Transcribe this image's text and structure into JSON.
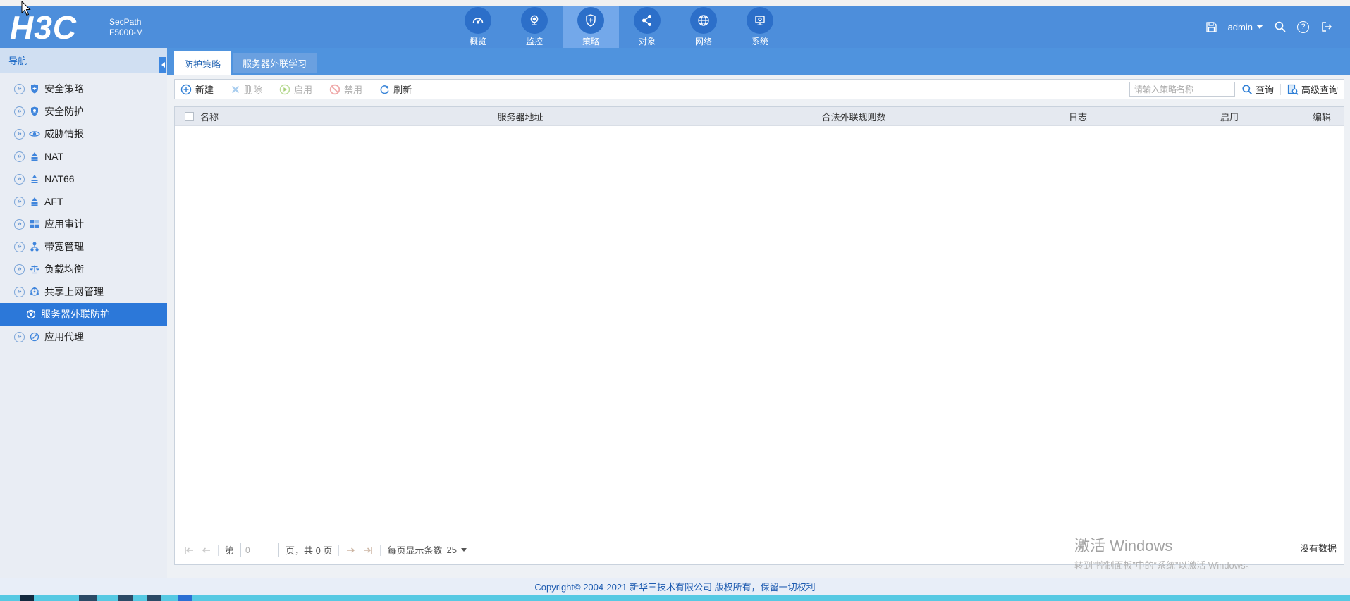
{
  "header": {
    "logo_text": "H3C",
    "product_name_line1": "SecPath",
    "product_name_line2": "F5000-M",
    "nav_items": [
      {
        "label": "概览",
        "icon": "gauge-icon",
        "active": false
      },
      {
        "label": "监控",
        "icon": "webcam-icon",
        "active": false
      },
      {
        "label": "策略",
        "icon": "shield-plus-icon",
        "active": true
      },
      {
        "label": "对象",
        "icon": "share-nodes-icon",
        "active": false
      },
      {
        "label": "网络",
        "icon": "globe-icon",
        "active": false
      },
      {
        "label": "系统",
        "icon": "system-monitor-icon",
        "active": false
      }
    ],
    "username": "admin"
  },
  "sidebar": {
    "title": "导航",
    "items": [
      {
        "label": "安全策略",
        "icon": "shield-plus-icon"
      },
      {
        "label": "安全防护",
        "icon": "shield-check-icon"
      },
      {
        "label": "威胁情报",
        "icon": "eye-icon"
      },
      {
        "label": "NAT",
        "icon": "nat-icon"
      },
      {
        "label": "NAT66",
        "icon": "nat-icon"
      },
      {
        "label": "AFT",
        "icon": "nat-icon"
      },
      {
        "label": "应用审计",
        "icon": "app-audit-icon"
      },
      {
        "label": "带宽管理",
        "icon": "bandwidth-icon"
      },
      {
        "label": "负载均衡",
        "icon": "load-balance-icon"
      },
      {
        "label": "共享上网管理",
        "icon": "shared-internet-icon"
      },
      {
        "label": "服务器外联防护",
        "icon": "server-outreach-icon",
        "selected": true
      },
      {
        "label": "应用代理",
        "icon": "app-proxy-icon"
      }
    ]
  },
  "tabs": [
    {
      "label": "防护策略",
      "active": true
    },
    {
      "label": "服务器外联学习",
      "active": false
    }
  ],
  "toolbar": {
    "new_label": "新建",
    "delete_label": "删除",
    "enable_label": "启用",
    "disable_label": "禁用",
    "refresh_label": "刷新",
    "search_placeholder": "请输入策略名称",
    "query_label": "查询",
    "advanced_query_label": "高级查询"
  },
  "table": {
    "columns": [
      "名称",
      "服务器地址",
      "合法外联规则数",
      "日志",
      "启用",
      "编辑"
    ],
    "rows": [],
    "empty_text": "没有数据"
  },
  "pagination": {
    "page_label_before": "第",
    "page_value": "0",
    "page_label_after": "页，共 0 页",
    "per_page_label": "每页显示条数",
    "per_page_value": "25"
  },
  "watermark": {
    "title": "激活 Windows",
    "subtitle": "转到“控制面板”中的“系统”以激活 Windows。"
  },
  "footer": {
    "copyright": "Copyright© 2004-2021 新华三技术有限公司 版权所有，保留一切权利"
  },
  "colors": {
    "header_blue": "#4d8edb",
    "nav_active_blue": "#73a8ea",
    "nav_circle_blue": "#2c6fc9",
    "selected_item_blue": "#2c78d9",
    "accent_blue": "#2f7fd6",
    "taskbar_cyan": "#56c9e3"
  }
}
